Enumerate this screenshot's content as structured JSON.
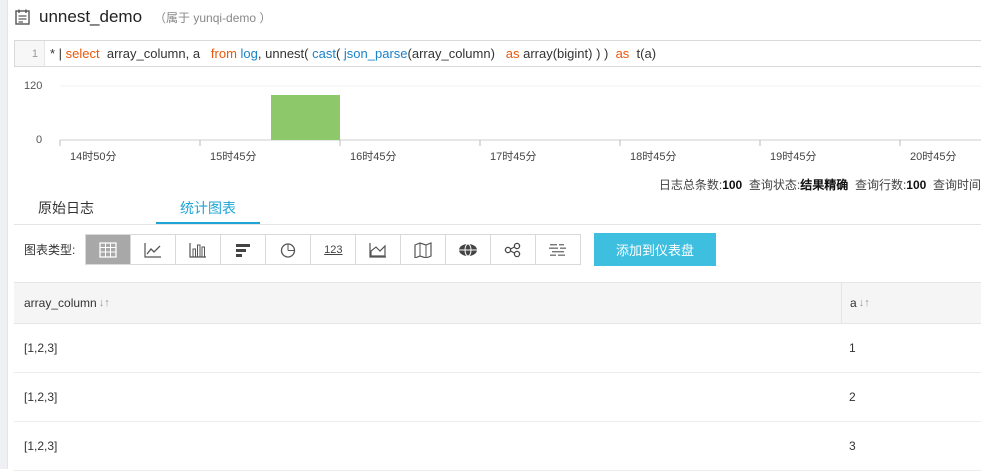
{
  "header": {
    "title": "unnest_demo",
    "subtitle": "（属于 yunqi-demo ）"
  },
  "query": {
    "line_number": "1",
    "tokens": [
      {
        "t": "* | ",
        "c": "star"
      },
      {
        "t": "select",
        "c": "kw"
      },
      {
        "t": "  array_column, a   ",
        "c": ""
      },
      {
        "t": "from",
        "c": "kw"
      },
      {
        "t": " ",
        "c": ""
      },
      {
        "t": "log",
        "c": "fn"
      },
      {
        "t": ", unnest( ",
        "c": ""
      },
      {
        "t": "cast",
        "c": "fn"
      },
      {
        "t": "( ",
        "c": ""
      },
      {
        "t": "json_parse",
        "c": "fn"
      },
      {
        "t": "(array_column)   ",
        "c": ""
      },
      {
        "t": "as",
        "c": "kw"
      },
      {
        "t": " array(bigint) ) )  ",
        "c": ""
      },
      {
        "t": "as",
        "c": "kw"
      },
      {
        "t": "  t(a)",
        "c": ""
      }
    ]
  },
  "histogram": {
    "y_max_label": "120",
    "y_min_label": "0",
    "x_ticks": [
      "14时50分",
      "15时45分",
      "16时45分",
      "17时45分",
      "18时45分",
      "19时45分",
      "20时45分"
    ],
    "bar_value": 100,
    "bar_color": "#8dc86a"
  },
  "stats": {
    "total_label": "日志总条数:",
    "total_value": "100",
    "status_label": "查询状态:",
    "status_value": "结果精确",
    "rows_label": "查询行数:",
    "rows_value": "100",
    "time_label": "查询时间"
  },
  "tabs": {
    "raw": "原始日志",
    "chart": "统计图表"
  },
  "chart_type": {
    "label": "图表类型:",
    "buttons": [
      "table-icon",
      "line-chart-icon",
      "bar-chart-icon",
      "horizontal-bar-icon",
      "pie-chart-icon",
      "number-icon",
      "area-chart-icon",
      "map-icon",
      "world-map-icon",
      "flow-icon",
      "word-cloud-icon"
    ],
    "number_text": "123"
  },
  "add_button": "添加到仪表盘",
  "table": {
    "columns": [
      "array_column",
      "a"
    ],
    "sort_glyph": "↓↑",
    "rows": [
      [
        "[1,2,3]",
        "1"
      ],
      [
        "[1,2,3]",
        "2"
      ],
      [
        "[1,2,3]",
        "3"
      ]
    ]
  }
}
